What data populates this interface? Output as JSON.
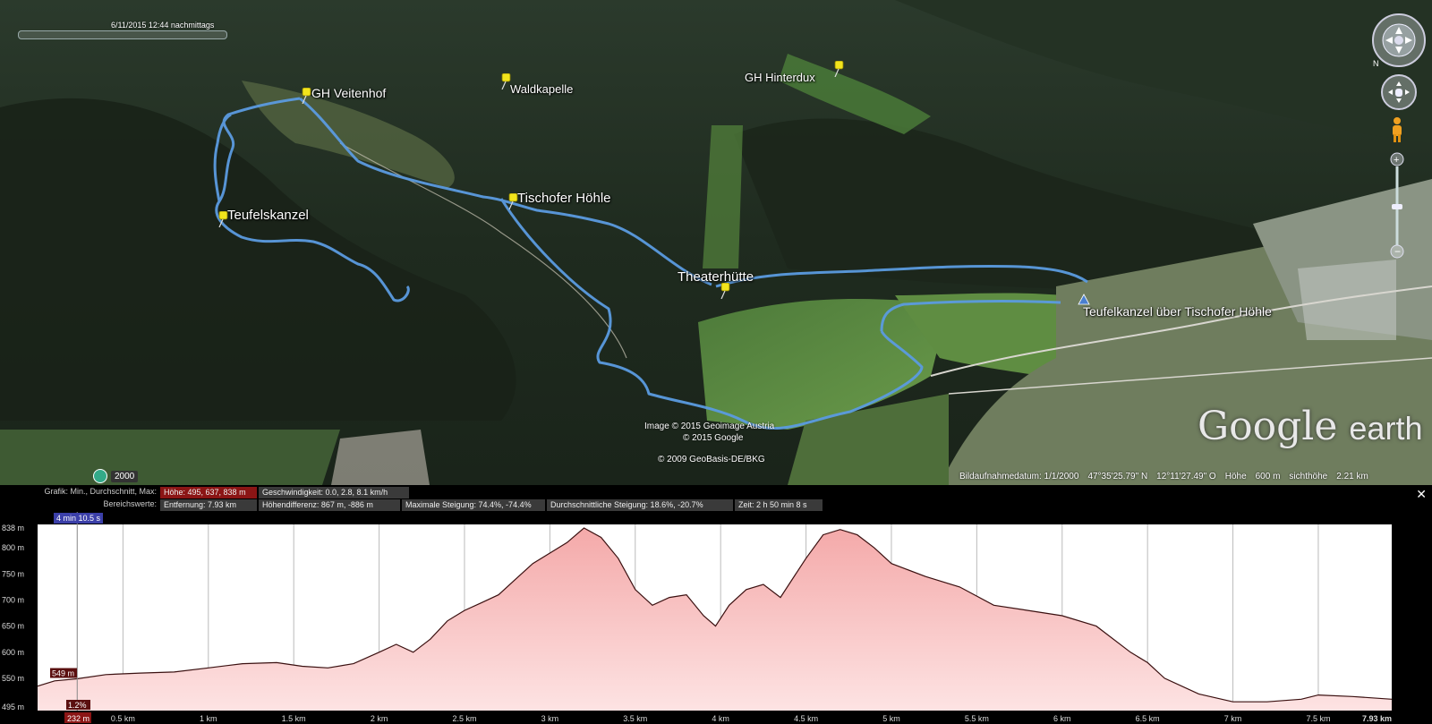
{
  "map": {
    "timestamp": "6/11/2015  12:44 nachmittags",
    "placemarks": [
      {
        "id": "gh-veitenhof",
        "label": "GH Veitenhof"
      },
      {
        "id": "waldkapelle",
        "label": "Waldkapelle"
      },
      {
        "id": "gh-hinterdux",
        "label": "GH Hinterdux"
      },
      {
        "id": "tischofer-hoehle",
        "label": "Tischofer Höhle"
      },
      {
        "id": "teufelskanzel",
        "label": "Teufelskanzel"
      },
      {
        "id": "theaterhuette",
        "label": "Theaterhütte"
      },
      {
        "id": "route-name",
        "label": "Teufelkanzel über Tischofer Höhle"
      }
    ],
    "credits": [
      "Image © 2015 Geoimage Austria",
      "© 2015 Google",
      "© 2009 GeoBasis-DE/BKG"
    ],
    "logo_main": "Google",
    "logo_sub": "earth",
    "year_badge": "2000",
    "status": {
      "imagery_date": "Bildaufnahmedatum: 1/1/2000",
      "lat": "47°35'25.79\" N",
      "lon": "12°11'27.49\" O",
      "elev_label": "Höhe",
      "elev": "600 m",
      "eye_label": "sichthöhe",
      "eye": "2.21 km"
    }
  },
  "profile": {
    "row1_label": "Grafik: Min., Durchschnitt, Max:",
    "row1_cells": [
      "Höhe: 495, 637, 838 m",
      "Geschwindigkeit: 0.0, 2.8, 8.1 km/h"
    ],
    "row2_label": "Bereichswerte:",
    "row2_cells": [
      "Entfernung: 7.93 km",
      "Höhendifferenz: 867 m, -886 m",
      "Maximale Steigung: 74.4%, -74.4%",
      "Durchschnittliche Steigung: 18.6%, -20.7%",
      "Zeit: 2 h 50 min 8 s"
    ],
    "time_badge": "4 min 10.5 s",
    "cursor_elev": "549 m",
    "cursor_grade": "1.2%",
    "cursor_dist": "232 m",
    "close": "✕"
  },
  "chart_data": {
    "type": "area",
    "xlabel": "",
    "ylabel": "",
    "xlim": [
      0,
      7.93
    ],
    "ylim": [
      495,
      838
    ],
    "yticks": [
      "838 m",
      "800 m",
      "750 m",
      "700 m",
      "650 m",
      "600 m",
      "550 m",
      "495 m"
    ],
    "ytick_values": [
      838,
      800,
      750,
      700,
      650,
      600,
      550,
      495
    ],
    "xticks": [
      "0.5 km",
      "1 km",
      "1.5 km",
      "2 km",
      "2.5 km",
      "3 km",
      "3.5 km",
      "4 km",
      "4.5 km",
      "5 km",
      "5.5 km",
      "6 km",
      "6.5 km",
      "7 km",
      "7.5 km",
      "7.93 km"
    ],
    "xtick_values": [
      0.5,
      1,
      1.5,
      2,
      2.5,
      3,
      3.5,
      4,
      4.5,
      5,
      5.5,
      6,
      6.5,
      7,
      7.5,
      7.93
    ],
    "x": [
      0,
      0.1,
      0.23,
      0.4,
      0.6,
      0.8,
      1.0,
      1.2,
      1.4,
      1.55,
      1.7,
      1.85,
      2.0,
      2.1,
      2.2,
      2.3,
      2.4,
      2.5,
      2.6,
      2.7,
      2.8,
      2.9,
      3.0,
      3.1,
      3.2,
      3.3,
      3.4,
      3.5,
      3.6,
      3.7,
      3.8,
      3.9,
      3.97,
      4.05,
      4.15,
      4.25,
      4.35,
      4.5,
      4.6,
      4.7,
      4.8,
      4.9,
      5.0,
      5.2,
      5.4,
      5.6,
      5.8,
      6.0,
      6.2,
      6.4,
      6.5,
      6.6,
      6.8,
      7.0,
      7.2,
      7.4,
      7.5,
      7.7,
      7.93
    ],
    "series": [
      {
        "values": [
          535,
          545,
          549,
          557,
          560,
          562,
          570,
          578,
          580,
          573,
          570,
          578,
          600,
          615,
          600,
          625,
          660,
          680,
          695,
          710,
          740,
          770,
          790,
          810,
          838,
          820,
          780,
          720,
          690,
          705,
          710,
          670,
          650,
          690,
          720,
          730,
          705,
          780,
          825,
          835,
          825,
          800,
          770,
          745,
          725,
          690,
          680,
          670,
          650,
          600,
          580,
          550,
          520,
          505,
          505,
          510,
          518,
          515,
          510
        ]
      }
    ]
  }
}
